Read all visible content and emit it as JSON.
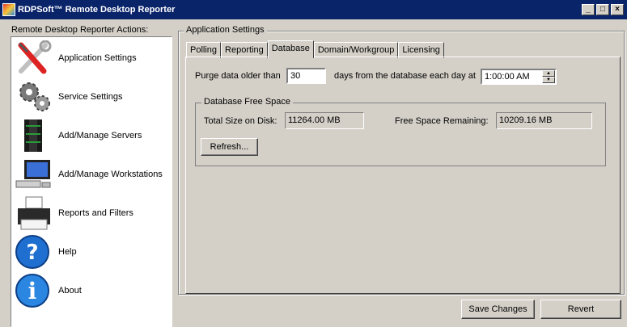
{
  "window": {
    "title": "RDPSoft™ Remote Desktop Reporter"
  },
  "left": {
    "heading": "Remote Desktop Reporter Actions:",
    "items": [
      {
        "label": "Application Settings",
        "icon": "tools-icon"
      },
      {
        "label": "Service Settings",
        "icon": "gears-icon"
      },
      {
        "label": "Add/Manage Servers",
        "icon": "server-icon"
      },
      {
        "label": "Add/Manage Workstations",
        "icon": "workstation-icon"
      },
      {
        "label": "Reports and Filters",
        "icon": "printer-icon"
      },
      {
        "label": "Help",
        "icon": "help-icon"
      },
      {
        "label": "About",
        "icon": "info-icon"
      }
    ]
  },
  "settings": {
    "group_title": "Application Settings",
    "tabs": [
      {
        "label": "Polling",
        "active": false
      },
      {
        "label": "Reporting",
        "active": false
      },
      {
        "label": "Database",
        "active": true
      },
      {
        "label": "Domain/Workgroup",
        "active": false
      },
      {
        "label": "Licensing",
        "active": false
      }
    ],
    "purge_label": "Purge data older than",
    "purge_days": "30",
    "purge_suffix": "days from the database each day at",
    "purge_time": "1:00:00 AM",
    "free_space": {
      "title": "Database Free Space",
      "total_label": "Total Size on Disk:",
      "total_value": "11264.00 MB",
      "remaining_label": "Free Space Remaining:",
      "remaining_value": "10209.16 MB",
      "refresh_label": "Refresh..."
    }
  },
  "footer": {
    "save_label": "Save Changes",
    "revert_label": "Revert"
  },
  "colors": {
    "titlebar": "#0a246a",
    "face": "#d4d0c8",
    "help_blue": "#1f6fd1"
  }
}
